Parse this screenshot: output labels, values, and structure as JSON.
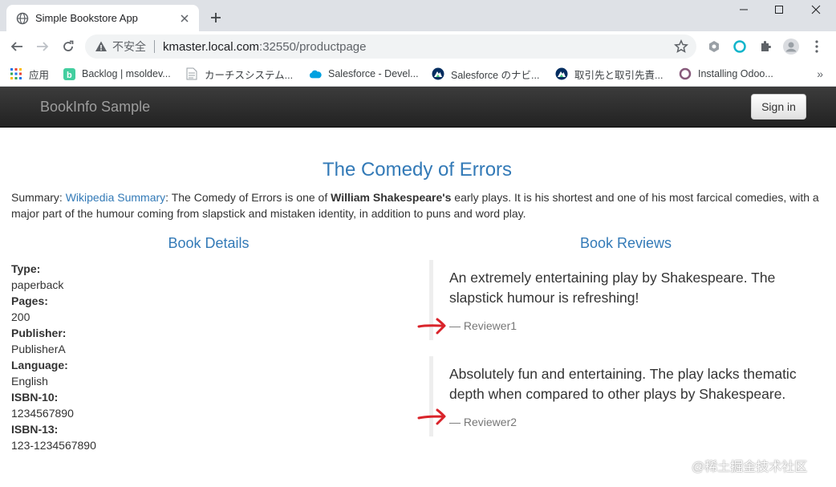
{
  "browser": {
    "tab_title": "Simple Bookstore App",
    "insecure_label": "不安全",
    "url_host": "kmaster.local.com",
    "url_rest": ":32550/productpage",
    "bookmarks": [
      {
        "label": "应用",
        "icon": "apps-grid-icon"
      },
      {
        "label": "Backlog | msoldev...",
        "icon": "backlog-icon"
      },
      {
        "label": "カーチスシステム...",
        "icon": "document-icon"
      },
      {
        "label": "Salesforce - Devel...",
        "icon": "salesforce-cloud-icon"
      },
      {
        "label": "Salesforce のナビ...",
        "icon": "trail-icon"
      },
      {
        "label": "取引先と取引先責...",
        "icon": "trail-icon"
      },
      {
        "label": "Installing Odoo...",
        "icon": "odoo-icon"
      }
    ],
    "more_bookmarks": "»"
  },
  "navbar": {
    "brand": "BookInfo Sample",
    "signin": "Sign in"
  },
  "product": {
    "title": "The Comedy of Errors",
    "summary_label": "Summary: ",
    "summary_link": "Wikipedia Summary",
    "summary_pre": ": The Comedy of Errors is one of ",
    "summary_bold": "William Shakespeare's",
    "summary_post": " early plays. It is his shortest and one of his most farcical comedies, with a major part of the humour coming from slapstick and mistaken identity, in addition to puns and word play."
  },
  "details": {
    "heading": "Book Details",
    "type_label": "Type:",
    "type": "paperback",
    "pages_label": "Pages:",
    "pages": "200",
    "publisher_label": "Publisher:",
    "publisher": "PublisherA",
    "language_label": "Language:",
    "language": "English",
    "isbn10_label": "ISBN-10:",
    "isbn10": "1234567890",
    "isbn13_label": "ISBN-13:",
    "isbn13": "123-1234567890"
  },
  "reviews": {
    "heading": "Book Reviews",
    "items": [
      {
        "text": "An extremely entertaining play by Shakespeare. The slapstick humour is refreshing!",
        "reviewer": "— Reviewer1"
      },
      {
        "text": "Absolutely fun and entertaining. The play lacks thematic depth when compared to other plays by Shakespeare.",
        "reviewer": "— Reviewer2"
      }
    ]
  },
  "watermark": "@稀土掘金技术社区",
  "colors": {
    "link": "#337ab7",
    "navbar": "#222222",
    "annotation_arrow": "#d9232a"
  }
}
